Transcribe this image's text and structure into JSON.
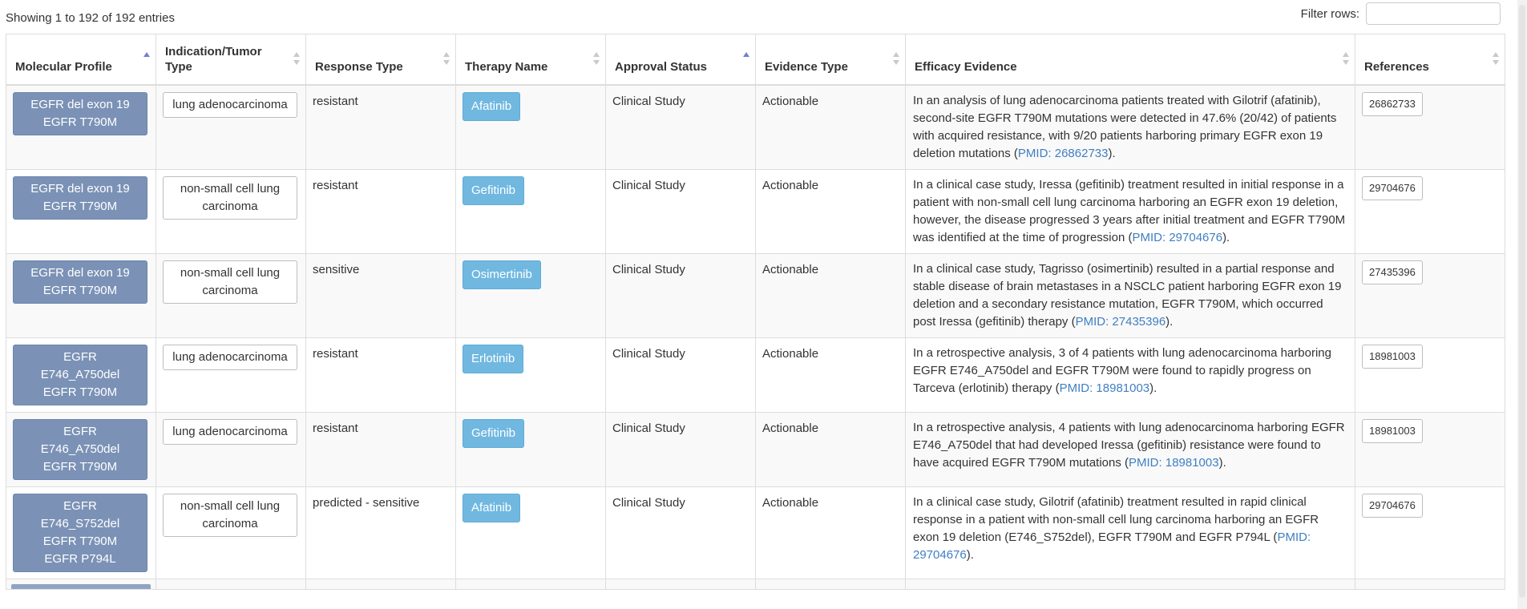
{
  "info_text": "Showing 1 to 192 of 192 entries",
  "filter": {
    "label": "Filter rows:",
    "value": ""
  },
  "columns": [
    {
      "label": "Molecular Profile",
      "sort": "asc"
    },
    {
      "label": "Indication/Tumor Type",
      "sort": "both"
    },
    {
      "label": "Response Type",
      "sort": "both"
    },
    {
      "label": "Therapy Name",
      "sort": "both"
    },
    {
      "label": "Approval Status",
      "sort": "asc"
    },
    {
      "label": "Evidence Type",
      "sort": "both"
    },
    {
      "label": "Efficacy Evidence",
      "sort": "both"
    },
    {
      "label": "References",
      "sort": "both"
    }
  ],
  "rows": [
    {
      "profile": [
        "EGFR del exon 19",
        "EGFR T790M"
      ],
      "tumor": "lung adenocarcinoma",
      "response": "resistant",
      "therapy": "Afatinib",
      "approval": "Clinical Study",
      "evidence_type": "Actionable",
      "evidence_text": "In an analysis of lung adenocarcinoma patients treated with Gilotrif (afatinib), second-site EGFR T790M mutations were detected in 47.6% (20/42) of patients with acquired resistance, with 9/20 patients harboring primary EGFR exon 19 deletion mutations (",
      "pmid": "PMID: 26862733",
      "evidence_end": ").",
      "reference": "26862733"
    },
    {
      "profile": [
        "EGFR del exon 19",
        "EGFR T790M"
      ],
      "tumor": "non-small cell lung carcinoma",
      "response": "resistant",
      "therapy": "Gefitinib",
      "approval": "Clinical Study",
      "evidence_type": "Actionable",
      "evidence_text": "In a clinical case study, Iressa (gefitinib) treatment resulted in initial response in a patient with non-small cell lung carcinoma harboring an EGFR exon 19 deletion, however, the disease progressed 3 years after initial treatment and EGFR T790M was identified at the time of progression (",
      "pmid": "PMID: 29704676",
      "evidence_end": ").",
      "reference": "29704676"
    },
    {
      "profile": [
        "EGFR del exon 19",
        "EGFR T790M"
      ],
      "tumor": "non-small cell lung carcinoma",
      "response": "sensitive",
      "therapy": "Osimertinib",
      "approval": "Clinical Study",
      "evidence_type": "Actionable",
      "evidence_text": "In a clinical case study, Tagrisso (osimertinib) resulted in a partial response and stable disease of brain metastases in a NSCLC patient harboring EGFR exon 19 deletion and a secondary resistance mutation, EGFR T790M, which occurred post Iressa (gefitinib) therapy (",
      "pmid": "PMID: 27435396",
      "evidence_end": ").",
      "reference": "27435396"
    },
    {
      "profile": [
        "EGFR",
        "E746_A750del",
        "EGFR T790M"
      ],
      "tumor": "lung adenocarcinoma",
      "response": "resistant",
      "therapy": "Erlotinib",
      "approval": "Clinical Study",
      "evidence_type": "Actionable",
      "evidence_text": "In a retrospective analysis, 3 of 4 patients with lung adenocarcinoma harboring EGFR E746_A750del and EGFR T790M were found to rapidly progress on Tarceva (erlotinib) therapy (",
      "pmid": "PMID: 18981003",
      "evidence_end": ").",
      "reference": "18981003"
    },
    {
      "profile": [
        "EGFR",
        "E746_A750del",
        "EGFR T790M"
      ],
      "tumor": "lung adenocarcinoma",
      "response": "resistant",
      "therapy": "Gefitinib",
      "approval": "Clinical Study",
      "evidence_type": "Actionable",
      "evidence_text": "In a retrospective analysis, 4 patients with lung adenocarcinoma harboring EGFR E746_A750del that had developed Iressa (gefitinib) resistance were found to have acquired EGFR T790M mutations (",
      "pmid": "PMID: 18981003",
      "evidence_end": ").",
      "reference": "18981003"
    },
    {
      "profile": [
        "EGFR",
        "E746_S752del",
        "EGFR T790M",
        "EGFR P794L"
      ],
      "tumor": "non-small cell lung carcinoma",
      "response": "predicted - sensitive",
      "therapy": "Afatinib",
      "approval": "Clinical Study",
      "evidence_type": "Actionable",
      "evidence_text": "In a clinical case study, Gilotrif (afatinib) treatment resulted in rapid clinical response in a patient with non-small cell lung carcinoma harboring an EGFR exon 19 deletion (E746_S752del), EGFR T790M and EGFR P794L (",
      "pmid": "PMID: 29704676",
      "evidence_end": ").",
      "reference": "29704676"
    }
  ]
}
